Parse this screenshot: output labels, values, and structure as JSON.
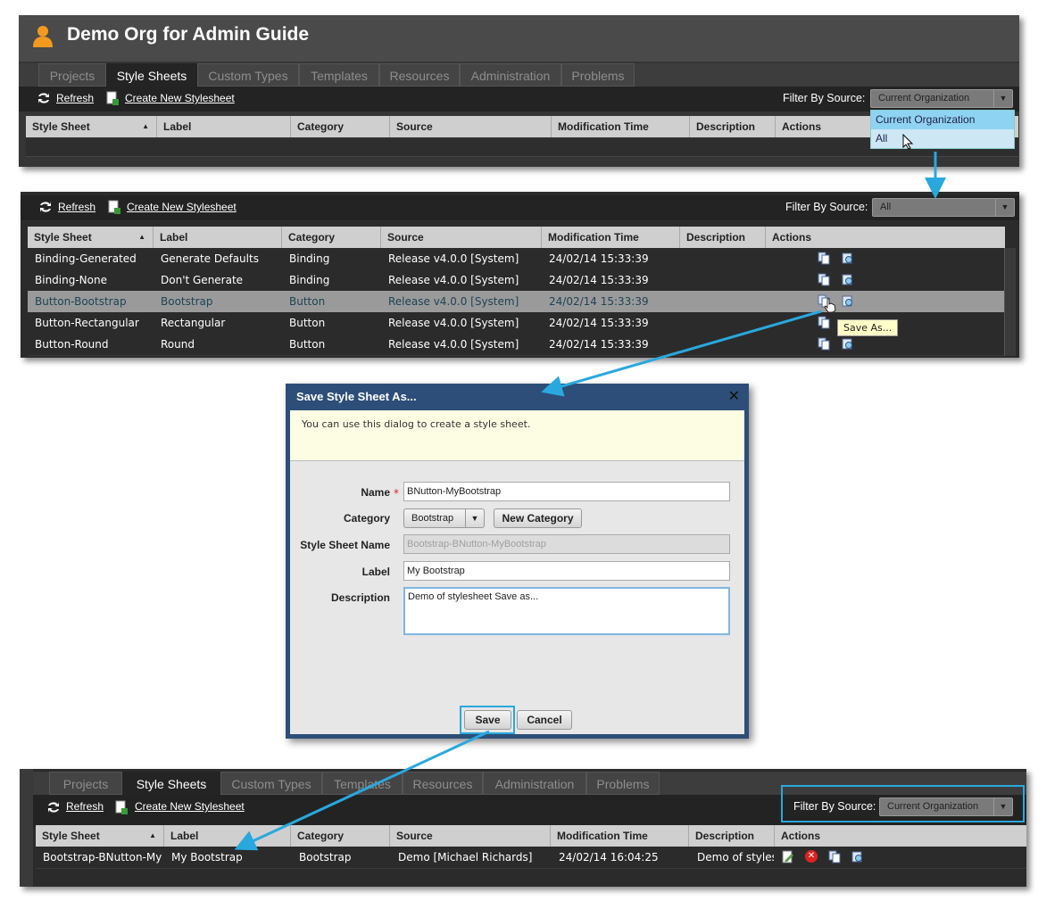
{
  "org": {
    "title": "Demo Org for Admin Guide"
  },
  "tabs": [
    "Projects",
    "Style Sheets",
    "Custom Types",
    "Templates",
    "Resources",
    "Administration",
    "Problems"
  ],
  "toolbar": {
    "refresh": "Refresh",
    "create": "Create New Stylesheet",
    "filter_label": "Filter By Source:"
  },
  "panel1": {
    "filter_value": "Current Organization",
    "dropdown": [
      "Current Organization",
      "All"
    ]
  },
  "columns": [
    "Style Sheet",
    "Label",
    "Category",
    "Source",
    "Modification Time",
    "Description",
    "Actions"
  ],
  "panel2": {
    "filter_value": "All",
    "rows": [
      {
        "name": "Binding-Generated",
        "label": "Generate Defaults",
        "category": "Binding",
        "source": "Release v4.0.0 [System]",
        "time": "24/02/14 15:33:39",
        "desc": ""
      },
      {
        "name": "Binding-None",
        "label": "Don't Generate",
        "category": "Binding",
        "source": "Release v4.0.0 [System]",
        "time": "24/02/14 15:33:39",
        "desc": ""
      },
      {
        "name": "Button-Bootstrap",
        "label": "Bootstrap",
        "category": "Button",
        "source": "Release v4.0.0 [System]",
        "time": "24/02/14 15:33:39",
        "desc": ""
      },
      {
        "name": "Button-Rectangular",
        "label": "Rectangular",
        "category": "Button",
        "source": "Release v4.0.0 [System]",
        "time": "24/02/14 15:33:39",
        "desc": ""
      },
      {
        "name": "Button-Round",
        "label": "Round",
        "category": "Button",
        "source": "Release v4.0.0 [System]",
        "time": "24/02/14 15:33:39",
        "desc": ""
      }
    ],
    "tooltip": "Save As..."
  },
  "dialog": {
    "title": "Save Style Sheet As...",
    "info": "You can use this dialog to create a style sheet.",
    "labels": {
      "name": "Name",
      "category": "Category",
      "stylesheet_name": "Style Sheet Name",
      "label": "Label",
      "description": "Description"
    },
    "values": {
      "name": "BNutton-MyBootstrap",
      "category": "Bootstrap",
      "stylesheet_name": "Bootstrap-BNutton-MyBootstrap",
      "label": "My Bootstrap",
      "description": "Demo of stylesheet Save as..."
    },
    "new_category": "New Category",
    "save": "Save",
    "cancel": "Cancel"
  },
  "panel3": {
    "filter_value": "Current Organization",
    "row": {
      "name": "Bootstrap-BNutton-MyBo",
      "label": "My Bootstrap",
      "category": "Bootstrap",
      "source": "Demo [Michael Richards]",
      "time": "24/02/14 16:04:25",
      "desc": "Demo of stylesh"
    }
  },
  "colors": {
    "accent": "#29a8de",
    "dialog_title": "#2d4e78",
    "selected_row": "#9a9a9a"
  }
}
